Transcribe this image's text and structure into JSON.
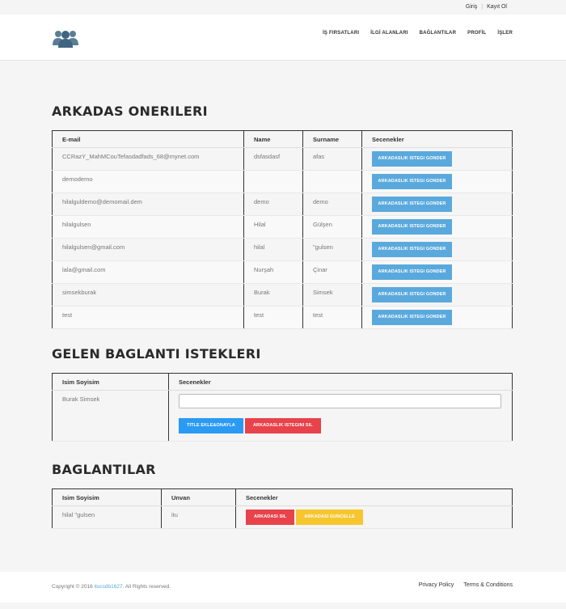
{
  "topbar": {
    "login": "Giriş",
    "register": "Kayıt Ol"
  },
  "nav": [
    "İŞ FIRSATLARI",
    "İLGİ ALANLARI",
    "BAĞLANTILAR",
    "PROFİL",
    "İŞLER"
  ],
  "friend_suggestions": {
    "title": "ARKADAS ONERILERI",
    "columns": [
      "E-mail",
      "Name",
      "Surname",
      "Secenekler"
    ],
    "button_label": "ARKADASLIK ISTEGI GONDER",
    "rows": [
      {
        "email": "CCRazY_MahMCouTefasdadfads_68@mynet.com",
        "name": "dsfasdasf",
        "surname": "afas"
      },
      {
        "email": "demodemo",
        "name": "",
        "surname": ""
      },
      {
        "email": "hilalguldemo@demomail.dem",
        "name": "demo",
        "surname": "demo"
      },
      {
        "email": "hilalgulsen",
        "name": "Hilal",
        "surname": "Gülşen"
      },
      {
        "email": "hilalgulsen@gmail.com",
        "name": "hilal",
        "surname": "\"gulsen"
      },
      {
        "email": "lala@gmail.com",
        "name": "Nurşah",
        "surname": "Çinar"
      },
      {
        "email": "simsekburak",
        "name": "Burak",
        "surname": "Simsek"
      },
      {
        "email": "test",
        "name": "test",
        "surname": "test"
      }
    ]
  },
  "incoming_requests": {
    "title": "GELEN BAGLANTI ISTEKLERI",
    "columns": [
      "Isim Soyisim",
      "Secenekler"
    ],
    "rows": [
      {
        "name": "Burak Simsek",
        "input_value": "",
        "approve_label": "TITLE EKLE&ONAYLA",
        "delete_label": "ARKADASLIK ISTEGINI SIL"
      }
    ]
  },
  "connections": {
    "title": "BAGLANTILAR",
    "columns": [
      "Isim Soyisim",
      "Unvan",
      "Secenekler"
    ],
    "rows": [
      {
        "name": "hilal \"gulsen",
        "title": "itu",
        "delete_label": "ARKADASI SIL",
        "update_label": "ARKADASI GUNCELLE"
      }
    ]
  },
  "footer": {
    "copyright_prefix": "Copyright © 2016 ",
    "copyright_link": "itucsdb1627",
    "copyright_suffix": ". All Rights reserved.",
    "privacy": "Privacy Policy",
    "terms": "Terms & Conditions"
  },
  "colors": {
    "primary_button": "#5aa9dd",
    "danger": "#e8424b",
    "warning": "#f7c62f",
    "accent": "#2b9af3"
  }
}
